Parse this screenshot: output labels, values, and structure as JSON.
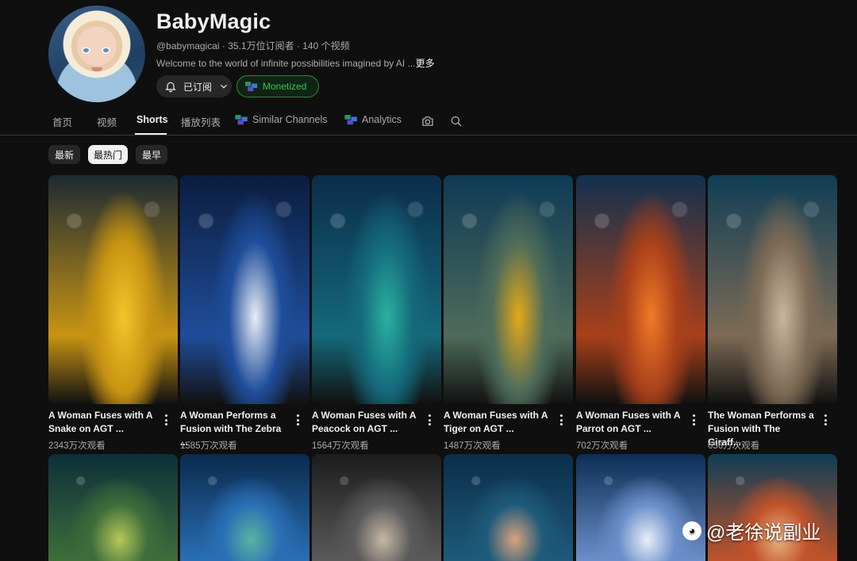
{
  "channel": {
    "name": "BabyMagic",
    "meta": "@babymagicai · 35.1万位订阅者 · 140 个视频",
    "description": "Welcome to the world of infinite possibilities imagined by AI ...",
    "more": "更多",
    "subscribed_label": "已订阅",
    "monetized_label": "Monetized"
  },
  "tabs": [
    {
      "label": "首页",
      "active": false
    },
    {
      "label": "视频",
      "active": false
    },
    {
      "label": "Shorts",
      "active": true
    },
    {
      "label": "播放列表",
      "active": false
    },
    {
      "label": "Similar Channels",
      "active": false
    },
    {
      "label": "Analytics",
      "active": false
    }
  ],
  "chips": [
    {
      "label": "最新",
      "active": false
    },
    {
      "label": "最热门",
      "active": true
    },
    {
      "label": "最早",
      "active": false
    }
  ],
  "shorts": [
    {
      "title": "A Woman Fuses with A Snake on AGT ...",
      "views": "2343万次观看",
      "colors": [
        "#1d2a33",
        "#c89412",
        "#f3c52a"
      ]
    },
    {
      "title": "A Woman Performs a Fusion with The Zebra ...",
      "views": "1585万次观看",
      "colors": [
        "#0b1d3f",
        "#1f4d9a",
        "#e9eef6"
      ]
    },
    {
      "title": "A Woman Fuses with A Peacock on AGT ...",
      "views": "1564万次观看",
      "colors": [
        "#0c2c4a",
        "#14697a",
        "#2bb0a0"
      ]
    },
    {
      "title": "A Woman Fuses with A Tiger on AGT ...",
      "views": "1487万次观看",
      "colors": [
        "#0e3a55",
        "#4e6b5a",
        "#e3a919"
      ]
    },
    {
      "title": "A Woman Fuses with A Parrot on AGT ...",
      "views": "702万次观看",
      "colors": [
        "#12304f",
        "#a8401a",
        "#f07a28"
      ]
    },
    {
      "title": "The Woman Performs a Fusion with The Giraff...",
      "views": "656万次观看",
      "colors": [
        "#0f3e55",
        "#7d6a55",
        "#c8b79e"
      ]
    }
  ],
  "shorts_row2": [
    {
      "colors": [
        "#0d2f3a",
        "#3f6d3a",
        "#b6c95a"
      ]
    },
    {
      "colors": [
        "#0a2a4d",
        "#2a6fb5",
        "#58b4a2"
      ]
    },
    {
      "colors": [
        "#1c1c1c",
        "#5a5a5a",
        "#c6b7a6"
      ]
    },
    {
      "colors": [
        "#0b2e4a",
        "#1e5a7a",
        "#d8a27e"
      ]
    },
    {
      "colors": [
        "#0c2d55",
        "#6b8fc9",
        "#e8eef8"
      ]
    },
    {
      "colors": [
        "#0f3d55",
        "#c0532a",
        "#e8b080"
      ]
    }
  ],
  "watermark": "@老徐说副业"
}
